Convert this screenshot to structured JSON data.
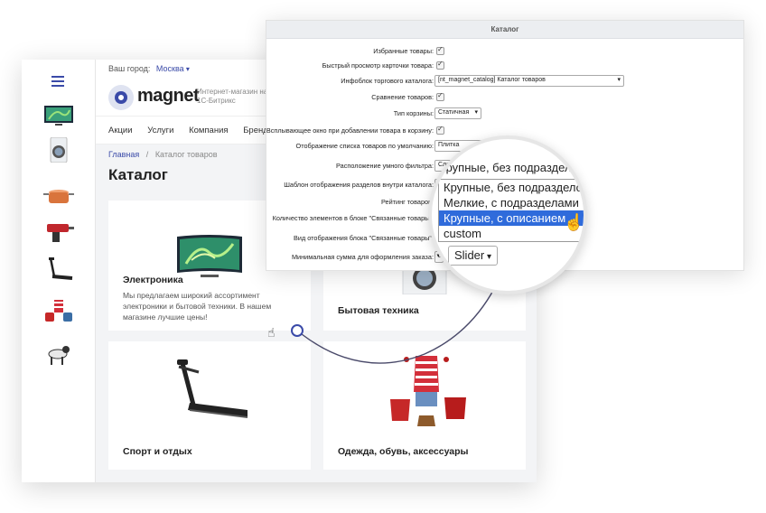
{
  "shop": {
    "city_label": "Ваш город:",
    "city_value": "Москва",
    "logo_text": "magnet",
    "logo_subtitle": "Интернет-магазин на 1С-Битрикс",
    "nav": [
      "Акции",
      "Услуги",
      "Компания",
      "Бренды"
    ],
    "breadcrumb": {
      "home": "Главная",
      "separator": "/",
      "current": "Каталог товаров"
    },
    "page_title": "Каталог",
    "categories": [
      {
        "name": "Электроника",
        "description": "Мы предлагаем широкий ассортимент электроники и бытовой техники. В нашем магазине лучшие цены!"
      },
      {
        "name": "Бытовая техника"
      },
      {
        "name": "Спорт и отдых"
      },
      {
        "name": "Одежда, обувь, аксессуары"
      }
    ],
    "rail_icons": [
      "tv-icon",
      "washing-machine-icon",
      "cookware-icon",
      "drill-icon",
      "treadmill-icon",
      "clothes-icon",
      "dog-icon"
    ]
  },
  "settings": {
    "title": "Каталог",
    "rows": [
      {
        "label": "Избранные товары:",
        "type": "checkbox"
      },
      {
        "label": "Быстрый просмотр карточки товара:",
        "type": "checkbox"
      },
      {
        "label": "Инфоблок торгового каталога:",
        "type": "select",
        "value": "[nt_magnet_catalog] Каталог товаров"
      },
      {
        "label": "Сравнение товаров:",
        "type": "checkbox"
      },
      {
        "label": "Тип корзины:",
        "type": "select",
        "value": "Статичная"
      },
      {
        "label": "Всплывающее окно при добавлении товара в корзину:",
        "type": "checkbox"
      },
      {
        "label": "Отображение списка товаров по умолчанию:",
        "type": "select",
        "value": "Плитка"
      },
      {
        "label": "Расположение умного фильтра:",
        "type": "select",
        "value": "Слева"
      },
      {
        "label": "Шаблон отображения разделов внутри каталога:",
        "type": "select",
        "value": "Кр"
      },
      {
        "label": "Рейтинг товаров:",
        "type": "checkbox"
      },
      {
        "label": "Количество элементов в блоке \"Связанные товары\":",
        "type": "select",
        "value": ""
      },
      {
        "label": "Вид отображения блока \"Связанные товары\":",
        "type": "select",
        "value": "s"
      },
      {
        "label": "Минимальная сумма для оформления заказа:",
        "type": "select",
        "value": "0"
      }
    ]
  },
  "magnifier": {
    "current_value": "Крупные, без подразделов",
    "options": [
      "Крупные, без подразделов",
      "Мелкие, с подразделами",
      "Крупные, с описанием",
      "custom"
    ],
    "highlighted_index": 2,
    "slider_value": "Slider"
  },
  "colors": {
    "accent": "#3a4aa8",
    "highlight": "#2f6bdb"
  }
}
